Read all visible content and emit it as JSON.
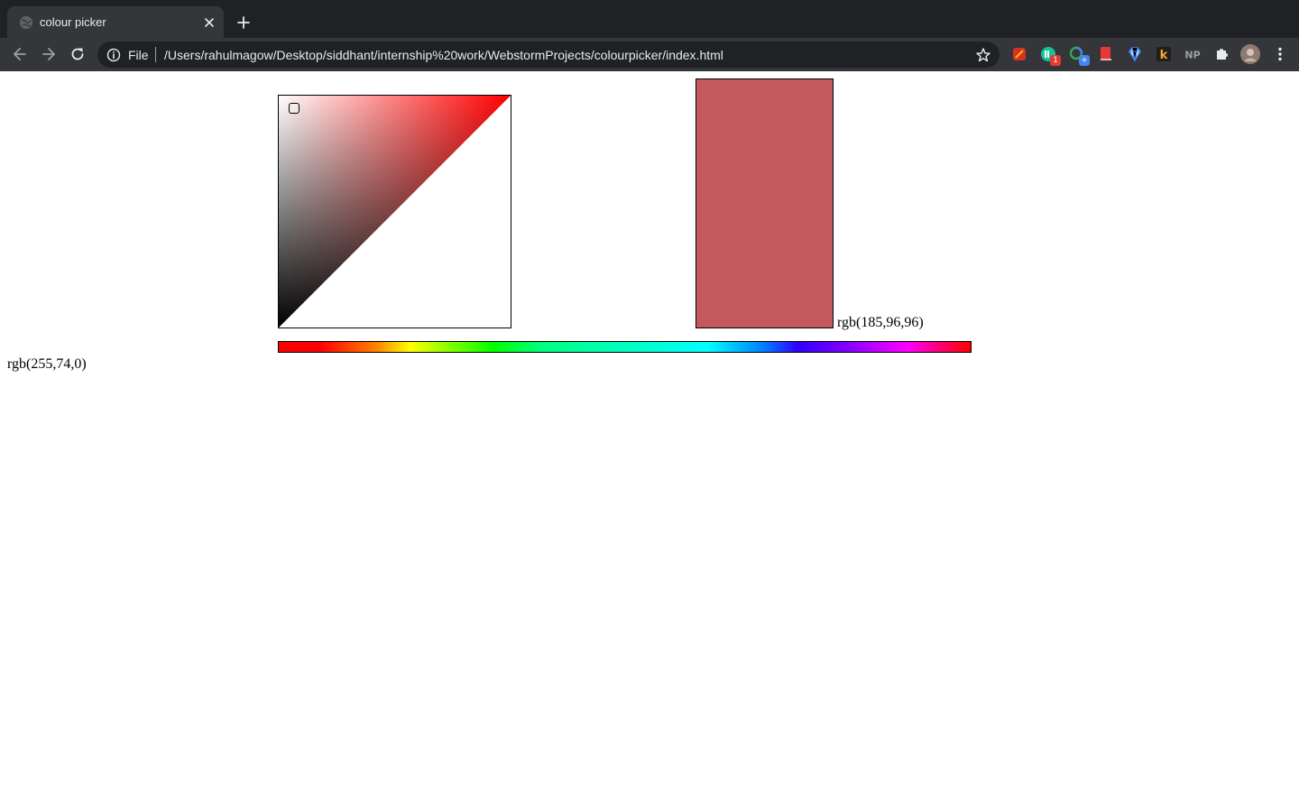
{
  "browser": {
    "tab": {
      "title": "colour picker"
    },
    "address_bar": {
      "scheme_label": "File",
      "url": "/Users/rahulmagow/Desktop/siddhant/internship%20work/WebstormProjects/colourpicker/index.html"
    },
    "extensions": [
      {
        "icon": "color-picker-extension-icon",
        "badge": ""
      },
      {
        "icon": "grammarly-extension-icon",
        "badge": "1"
      },
      {
        "icon": "translate-extension-icon",
        "badge": "+"
      },
      {
        "icon": "bookmark-extension-icon",
        "badge": ""
      },
      {
        "icon": "diamond-extension-icon",
        "badge": ""
      },
      {
        "icon": "k-extension-icon",
        "badge": "k"
      },
      {
        "icon": "np-extension-icon",
        "badge": "NP"
      },
      {
        "icon": "puzzle-extensions-icon",
        "badge": ""
      },
      {
        "icon": "profile-avatar-icon",
        "badge": ""
      },
      {
        "icon": "menu-kebab-icon",
        "badge": ""
      }
    ]
  },
  "picker": {
    "base_hue_color": "#ff0000",
    "selected_color": "#c3585e",
    "selected_color_label": "rgb(185,96,96)",
    "hue_value_label": "rgb(255,74,0)"
  }
}
